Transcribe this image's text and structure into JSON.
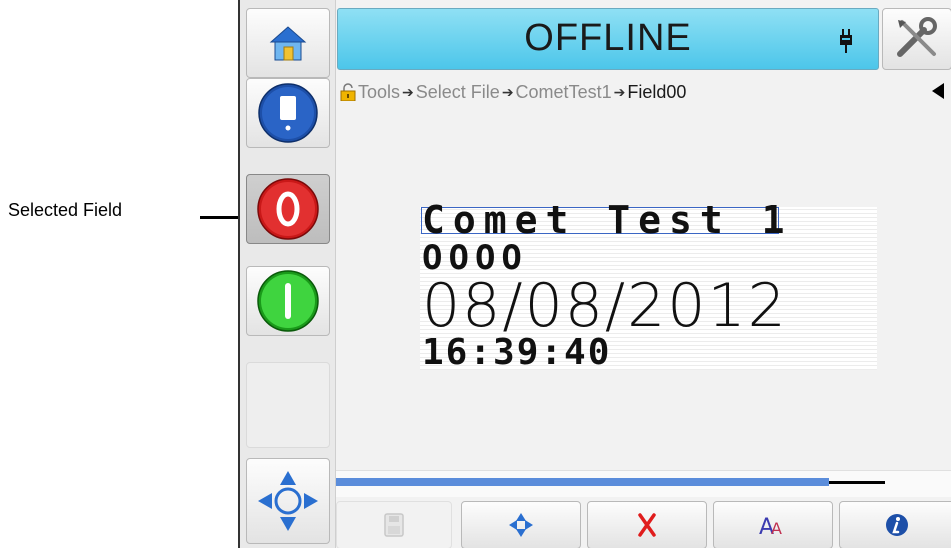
{
  "callout": {
    "label": "Selected Field"
  },
  "status": {
    "text": "OFFLINE",
    "color": "#4cc6ea"
  },
  "breadcrumb": {
    "items": [
      "Tools",
      "Select File",
      "CometTest1"
    ],
    "current": "Field00"
  },
  "preview": {
    "lines": [
      "Comet Test 1",
      "OOOO",
      "08/08/2012",
      "16:39:40"
    ],
    "selected_line": "Comet Test 1"
  },
  "left_buttons": [
    "home-icon",
    "ink-icon",
    "stop-icon",
    "start-icon",
    "navigate-icon"
  ],
  "toolbar": [
    "save-icon",
    "move-icon",
    "delete-icon",
    "font-icon",
    "info-icon"
  ],
  "scroll": {
    "position_fraction": 0.8
  },
  "colors": {
    "selection": "#3b66c4",
    "stop": "#e02020",
    "start": "#2cc22c",
    "accent_blue": "#2a6fd0"
  }
}
